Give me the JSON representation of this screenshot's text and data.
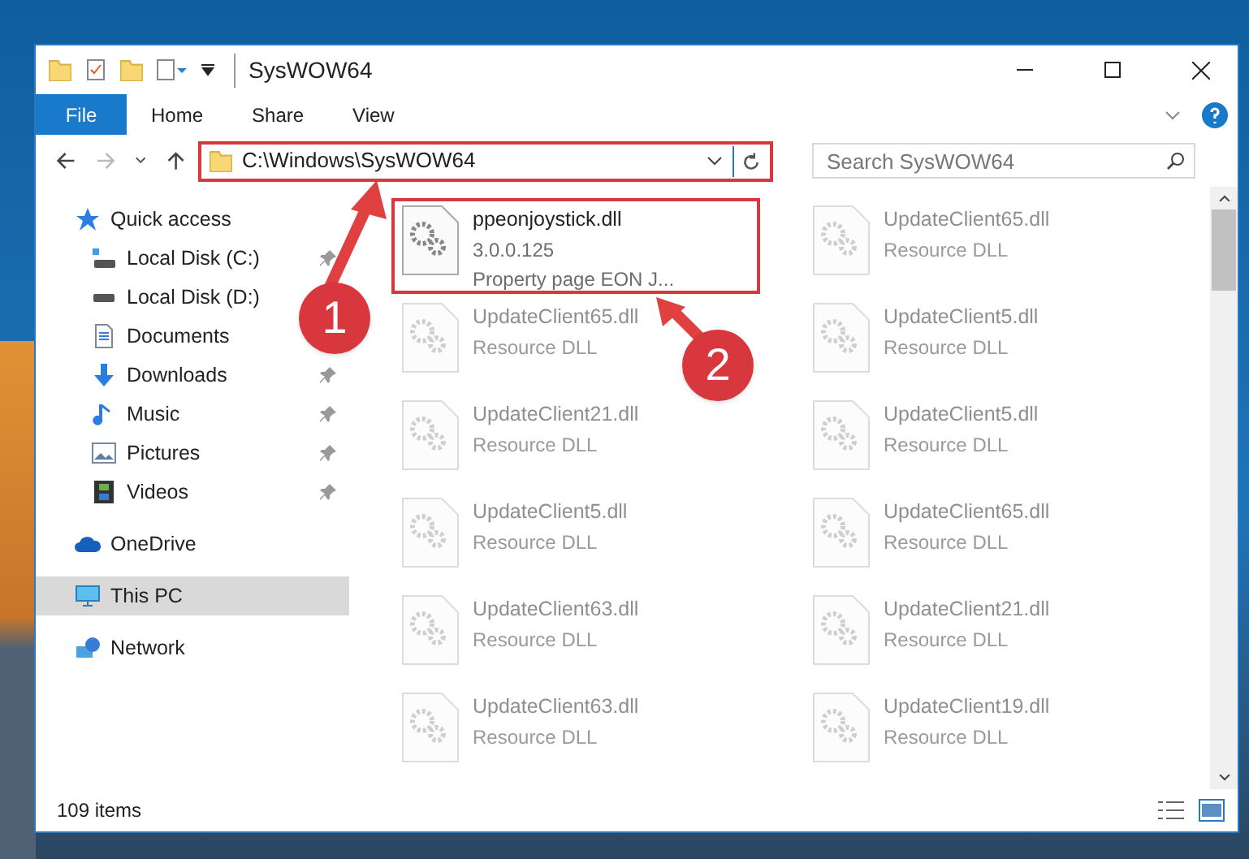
{
  "window": {
    "title": "SysWOW64"
  },
  "ribbon": {
    "file_tab": "File",
    "tabs": [
      "Home",
      "Share",
      "View"
    ]
  },
  "address": {
    "path": "C:\\Windows\\SysWOW64",
    "highlighted": true
  },
  "search": {
    "placeholder": "Search SysWOW64"
  },
  "sidebar": {
    "items": [
      {
        "label": "Quick access",
        "kind": "star",
        "selected": false,
        "children": [
          {
            "label": "Local Disk (C:)",
            "kind": "drive-c",
            "pinned": true
          },
          {
            "label": "Local Disk (D:)",
            "kind": "drive",
            "pinned": false
          },
          {
            "label": "Documents",
            "kind": "documents",
            "pinned": false
          },
          {
            "label": "Downloads",
            "kind": "downloads",
            "pinned": true
          },
          {
            "label": "Music",
            "kind": "music",
            "pinned": true
          },
          {
            "label": "Pictures",
            "kind": "pictures",
            "pinned": true
          },
          {
            "label": "Videos",
            "kind": "videos",
            "pinned": true
          }
        ]
      },
      {
        "label": "OneDrive",
        "kind": "cloud",
        "selected": false
      },
      {
        "label": "This PC",
        "kind": "pc",
        "selected": true
      },
      {
        "label": "Network",
        "kind": "network",
        "selected": false
      }
    ]
  },
  "files": [
    {
      "name": "ppeonjoystick.dll",
      "details": [
        "3.0.0.125",
        "Property page EON J..."
      ],
      "faded": false,
      "highlighted": true
    },
    {
      "name": "UpdateClient65.dll",
      "details": [
        "Resource DLL"
      ],
      "faded": true,
      "highlighted": false
    },
    {
      "name": "UpdateClient65.dll",
      "details": [
        "Resource DLL"
      ],
      "faded": true,
      "highlighted": false
    },
    {
      "name": "UpdateClient5.dll",
      "details": [
        "Resource DLL"
      ],
      "faded": true,
      "highlighted": false
    },
    {
      "name": "UpdateClient21.dll",
      "details": [
        "Resource DLL"
      ],
      "faded": true,
      "highlighted": false
    },
    {
      "name": "UpdateClient5.dll",
      "details": [
        "Resource DLL"
      ],
      "faded": true,
      "highlighted": false
    },
    {
      "name": "UpdateClient5.dll",
      "details": [
        "Resource DLL"
      ],
      "faded": true,
      "highlighted": false
    },
    {
      "name": "UpdateClient65.dll",
      "details": [
        "Resource DLL"
      ],
      "faded": true,
      "highlighted": false
    },
    {
      "name": "UpdateClient63.dll",
      "details": [
        "Resource DLL"
      ],
      "faded": true,
      "highlighted": false
    },
    {
      "name": "UpdateClient21.dll",
      "details": [
        "Resource DLL"
      ],
      "faded": true,
      "highlighted": false
    },
    {
      "name": "UpdateClient63.dll",
      "details": [
        "Resource DLL"
      ],
      "faded": true,
      "highlighted": false
    },
    {
      "name": "UpdateClient19.dll",
      "details": [
        "Resource DLL"
      ],
      "faded": true,
      "highlighted": false
    }
  ],
  "status_bar": {
    "item_count": "109 items"
  },
  "annotations": {
    "callouts": [
      "1",
      "2"
    ]
  }
}
